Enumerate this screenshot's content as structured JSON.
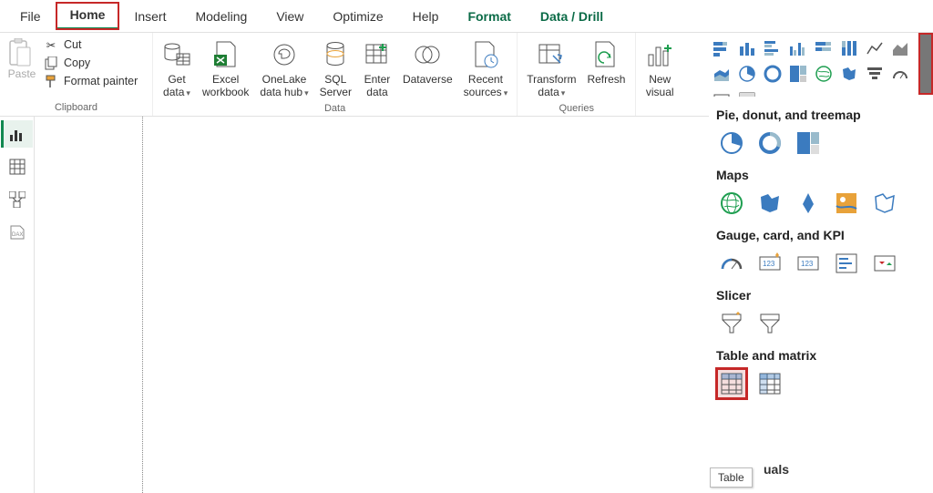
{
  "menu": {
    "items": [
      "File",
      "Home",
      "Insert",
      "Modeling",
      "View",
      "Optimize",
      "Help",
      "Format",
      "Data / Drill"
    ],
    "active": "Home"
  },
  "ribbon": {
    "clipboard": {
      "paste": "Paste",
      "cut": "Cut",
      "copy": "Copy",
      "format_painter": "Format painter",
      "group_label": "Clipboard"
    },
    "data": {
      "get_data": "Get\ndata",
      "excel": "Excel\nworkbook",
      "onelake": "OneLake\ndata hub",
      "sql": "SQL\nServer",
      "enter": "Enter\ndata",
      "dataverse": "Dataverse",
      "recent": "Recent\nsources",
      "group_label": "Data"
    },
    "queries": {
      "transform": "Transform\ndata",
      "refresh": "Refresh",
      "group_label": "Queries"
    },
    "insert": {
      "new_visual": "New\nvisual"
    }
  },
  "panel": {
    "sections": {
      "pie": "Pie, donut, and treemap",
      "maps": "Maps",
      "gauge": "Gauge, card, and KPI",
      "slicer": "Slicer",
      "table": "Table and matrix"
    },
    "truncated": "uals"
  },
  "tooltip": "Table"
}
